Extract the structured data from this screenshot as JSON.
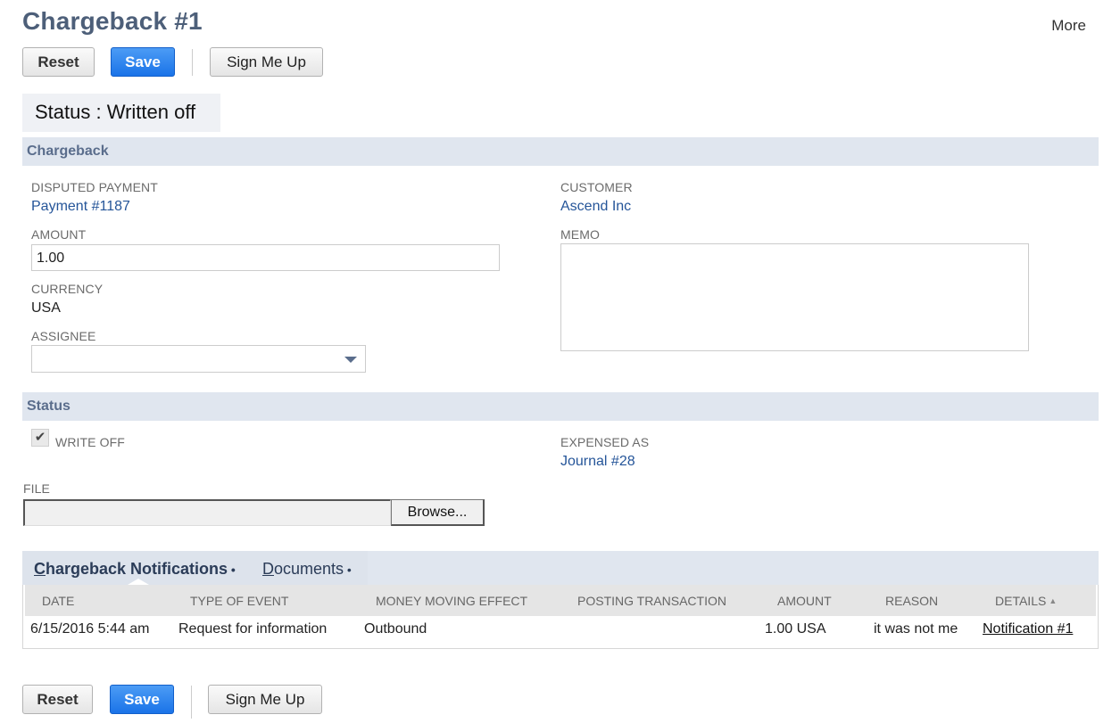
{
  "header": {
    "title": "Chargeback #1",
    "more_label": "More"
  },
  "toolbar": {
    "reset_label": "Reset",
    "save_label": "Save",
    "sign_up_label": "Sign Me Up"
  },
  "status_banner": "Status : Written off",
  "chargeback_section": {
    "title": "Chargeback",
    "disputed_payment": {
      "label": "DISPUTED PAYMENT",
      "value": "Payment #1187"
    },
    "amount": {
      "label": "AMOUNT",
      "value": "1.00"
    },
    "currency": {
      "label": "CURRENCY",
      "value": "USA"
    },
    "assignee": {
      "label": "ASSIGNEE",
      "value": ""
    },
    "customer": {
      "label": "CUSTOMER",
      "value": "Ascend Inc"
    },
    "memo": {
      "label": "MEMO",
      "value": ""
    }
  },
  "status_section": {
    "title": "Status",
    "write_off": {
      "label": "WRITE OFF",
      "checked": true,
      "check_glyph": "✔"
    },
    "expensed_as": {
      "label": "EXPENSED AS",
      "value": "Journal #28"
    },
    "file": {
      "label": "FILE",
      "browse_label": "Browse..."
    }
  },
  "tabs": [
    {
      "first_letter": "C",
      "rest": "hargeback Notifications",
      "dot": " •",
      "active": true
    },
    {
      "first_letter": "D",
      "rest": "ocuments",
      "dot": " •",
      "active": false
    }
  ],
  "notifications_table": {
    "columns": [
      "DATE",
      "TYPE OF EVENT",
      "MONEY MOVING EFFECT",
      "POSTING TRANSACTION",
      "AMOUNT",
      "REASON",
      "DETAILS"
    ],
    "sort_indicator": "▲",
    "rows": [
      {
        "date": "6/15/2016 5:44 am",
        "type_of_event": "Request for information",
        "money_moving_effect": "Outbound",
        "posting_transaction": "",
        "amount": "1.00 USA",
        "reason": "it was not me",
        "details": "Notification #1"
      }
    ]
  },
  "bottom_toolbar": {
    "reset_label": "Reset",
    "save_label": "Save",
    "sign_up_label": "Sign Me Up"
  },
  "colors": {
    "title": "#4d5f79",
    "primary_button": "#1a73e8",
    "section_bar": "#e0e6ef",
    "link": "#255599"
  }
}
